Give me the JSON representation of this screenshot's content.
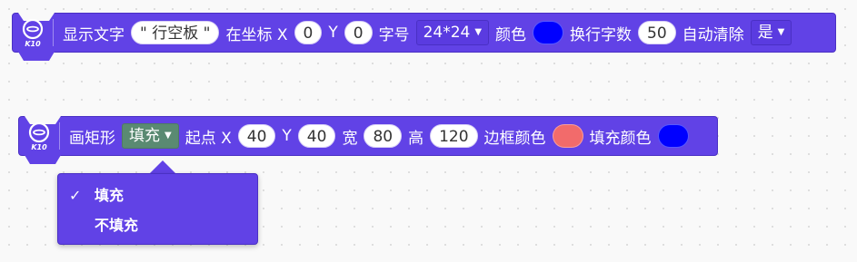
{
  "block1": {
    "icon": "k10-board-icon",
    "icon_text": "K10",
    "label_show_text": "显示文字",
    "text_value": "\" 行空板 \"",
    "label_at_x": "在坐标 X",
    "x_value": "0",
    "label_y": "Y",
    "y_value": "0",
    "label_font": "字号",
    "font_size_value": "24*24",
    "label_color": "颜色",
    "color": "#0000ff",
    "label_wrap": "换行字数",
    "wrap_value": "50",
    "label_autoclear": "自动清除",
    "autoclear_value": "是"
  },
  "block2": {
    "icon": "k10-board-icon",
    "icon_text": "K10",
    "label_draw_rect": "画矩形",
    "fill_value": "填充",
    "label_start_x": "起点 X",
    "x_value": "40",
    "label_y": "Y",
    "y_value": "40",
    "label_width": "宽",
    "width_value": "80",
    "label_height": "高",
    "height_value": "120",
    "label_border_color": "边框颜色",
    "border_color": "#f26b6b",
    "label_fill_color": "填充颜色",
    "fill_color": "#0000ff"
  },
  "dropdown_menu": {
    "items": [
      {
        "label": "填充",
        "selected": true,
        "check": "✓"
      },
      {
        "label": "不填充",
        "selected": false,
        "check": ""
      }
    ]
  },
  "colors": {
    "block_purple": "#6142e6",
    "dropdown_green": "#5a8a72"
  }
}
